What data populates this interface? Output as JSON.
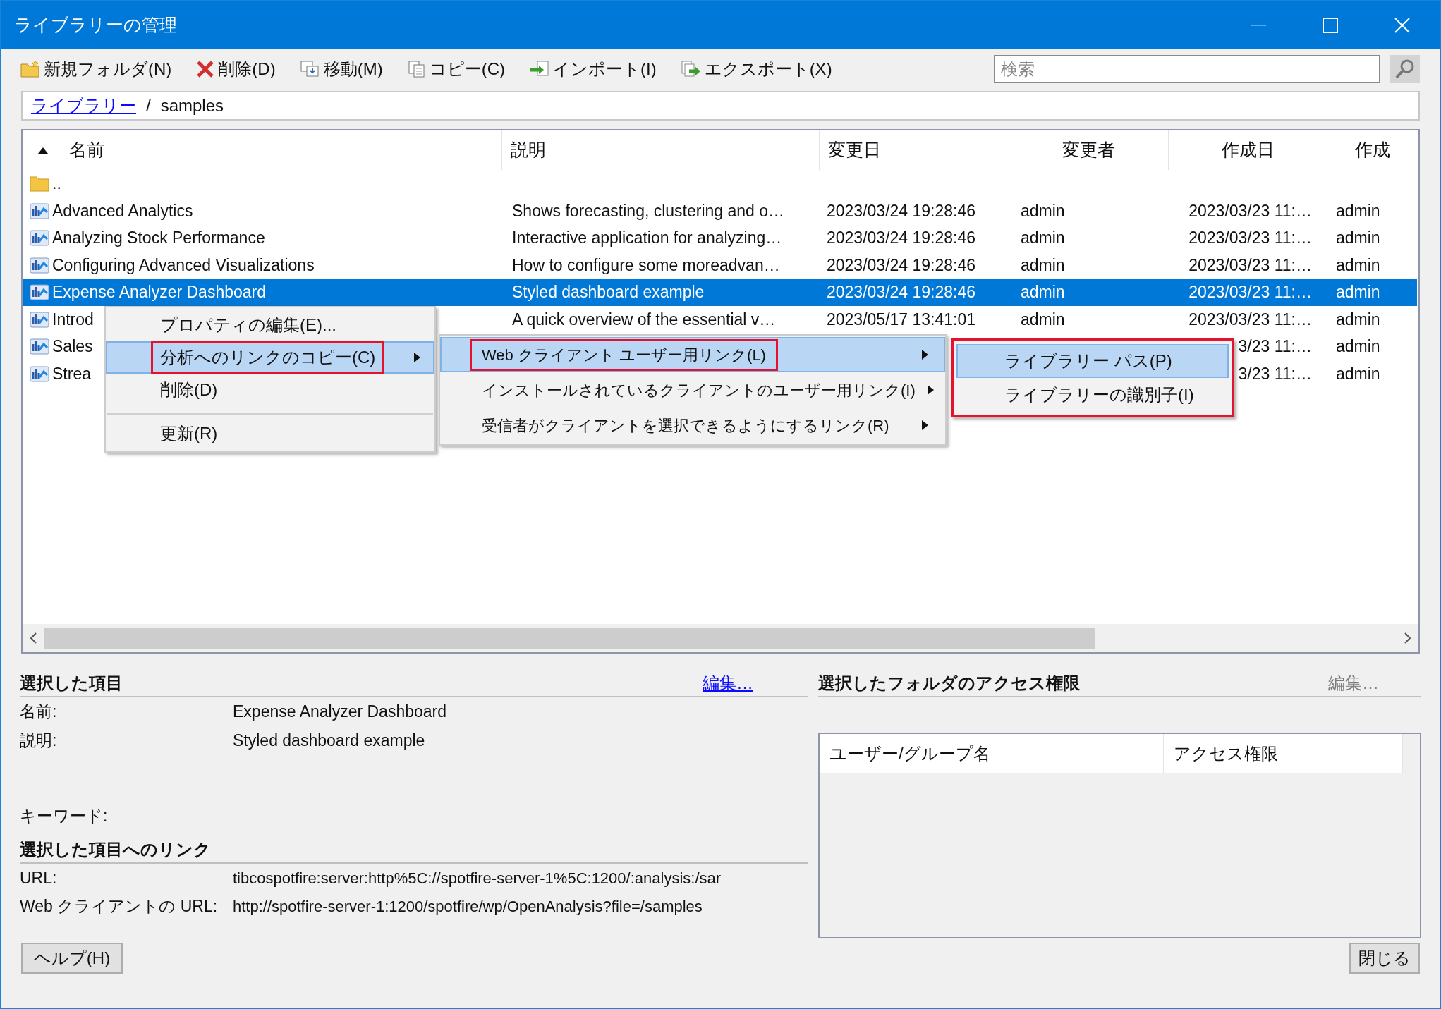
{
  "window": {
    "title": "ライブラリーの管理"
  },
  "toolbar": [
    {
      "label": "新規フォルダ(N)",
      "kind": "new-folder"
    },
    {
      "label": "削除(D)",
      "kind": "delete"
    },
    {
      "label": "移動(M)",
      "kind": "move"
    },
    {
      "label": "コピー(C)",
      "kind": "copy"
    },
    {
      "label": "インポート(I)",
      "kind": "import"
    },
    {
      "label": "エクスポート(X)",
      "kind": "export"
    }
  ],
  "search": {
    "placeholder": "検索"
  },
  "breadcrumb": [
    {
      "label": "ライブラリー",
      "kind": "link"
    },
    {
      "label": "/",
      "kind": "separator"
    },
    {
      "label": "samples",
      "kind": "current"
    }
  ],
  "table": {
    "columns": [
      {
        "label": "名前",
        "sorted": true
      },
      {
        "label": "説明",
        "sorted": false
      },
      {
        "label": "変更日",
        "sorted": false
      },
      {
        "label": "変更者",
        "sorted": false
      },
      {
        "label": "作成日",
        "sorted": false
      },
      {
        "label": "作成",
        "sorted": false
      }
    ],
    "rows": [
      {
        "kind": "parent",
        "name": "..",
        "selected": false
      },
      {
        "kind": "analysis",
        "name": "Advanced Analytics",
        "description": "Shows forecasting, clustering and o…",
        "modified": "2023/03/24 19:28:46",
        "modified_by": "admin",
        "created": "2023/03/23 11:…",
        "created_by": "admin",
        "selected": false
      },
      {
        "kind": "analysis",
        "name": "Analyzing Stock Performance",
        "description": "Interactive application for analyzing…",
        "modified": "2023/03/24 19:28:46",
        "modified_by": "admin",
        "created": "2023/03/23 11:…",
        "created_by": "admin",
        "selected": false
      },
      {
        "kind": "analysis",
        "name": "Configuring Advanced Visualizations",
        "description": "How to configure some moreadvan…",
        "modified": "2023/03/24 19:28:46",
        "modified_by": "admin",
        "created": "2023/03/23 11:…",
        "created_by": "admin",
        "selected": false
      },
      {
        "kind": "analysis",
        "name": "Expense Analyzer Dashboard",
        "description": "Styled dashboard example",
        "modified": "2023/03/24 19:28:46",
        "modified_by": "admin",
        "created": "2023/03/23 11:…",
        "created_by": "admin",
        "selected": true
      },
      {
        "kind": "analysis",
        "name": "Introd",
        "description": "A quick overview of the essential v…",
        "modified": "2023/05/17 13:41:01",
        "modified_by": "admin",
        "created": "2023/03/23 11:…",
        "created_by": "admin",
        "selected": false
      },
      {
        "kind": "analysis",
        "name": "Sales",
        "created": "3/23 11:…",
        "created_by": "admin",
        "selected": false
      },
      {
        "kind": "analysis",
        "name": "Strea",
        "created": "3/23 11:…",
        "created_by": "admin",
        "selected": false
      }
    ]
  },
  "context_menu": {
    "items": [
      {
        "label": "プロパティの編集(E)...",
        "selected": false,
        "annotated": false,
        "has_submenu": false,
        "separator_before": false
      },
      {
        "label": "分析へのリンクのコピー(C)",
        "selected": true,
        "annotated": true,
        "has_submenu": true,
        "separator_before": false
      },
      {
        "label": "削除(D)",
        "selected": false,
        "annotated": false,
        "has_submenu": false,
        "separator_before": false
      },
      {
        "label": "更新(R)",
        "selected": false,
        "annotated": false,
        "has_submenu": false,
        "separator_before": true
      }
    ]
  },
  "submenu": {
    "items": [
      {
        "label": "Web クライアント ユーザー用リンク(L)",
        "selected": true,
        "annotated": true,
        "has_submenu": true
      },
      {
        "label": "インストールされているクライアントのユーザー用リンク(I)",
        "selected": false,
        "annotated": false,
        "has_submenu": true
      },
      {
        "label": "受信者がクライアントを選択できるようにするリンク(R)",
        "selected": false,
        "annotated": false,
        "has_submenu": true
      }
    ]
  },
  "submenu_2": {
    "annotated": true,
    "items": [
      {
        "label": "ライブラリー パス(P)",
        "selected": true
      },
      {
        "label": "ライブラリーの識別子(I)",
        "selected": false
      }
    ]
  },
  "selected_item": {
    "title": "選択した項目",
    "edit_link": {
      "label": "編集…",
      "disabled": false
    },
    "fields": [
      {
        "label": "名前:",
        "value": "Expense Analyzer Dashboard",
        "kind": "single"
      },
      {
        "label": "説明:",
        "value": "Styled dashboard example",
        "kind": "multiline"
      },
      {
        "label": "キーワード:",
        "kind": "single"
      }
    ]
  },
  "links": {
    "title": "選択した項目へのリンク",
    "fields": [
      {
        "label": "URL:",
        "value": "tibcospotfire:server:http%5C://spotfire-server-1%5C:1200/:analysis:/sar"
      },
      {
        "label": "Web クライアントの URL:",
        "value": "http://spotfire-server-1:1200/spotfire/wp/OpenAnalysis?file=/samples"
      }
    ]
  },
  "access": {
    "title": "選択したフォルダのアクセス権限",
    "edit_link": {
      "label": "編集…",
      "disabled": true
    },
    "columns": [
      "ユーザー/グループ名",
      "アクセス権限"
    ]
  },
  "buttons": [
    {
      "label": "ヘルプ(H)"
    },
    {
      "label": "閉じる"
    }
  ]
}
